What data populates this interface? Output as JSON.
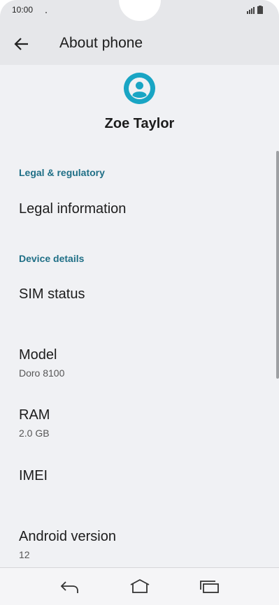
{
  "status_bar": {
    "time": "10:00"
  },
  "app_bar": {
    "title": "About phone",
    "back_icon": "arrow-left-icon"
  },
  "profile": {
    "name": "Zoe Taylor",
    "avatar_icon": "account-circle-icon",
    "accent": "#19a5c4"
  },
  "sections": {
    "legal": {
      "header": "Legal & regulatory",
      "legal_information": "Legal information"
    },
    "device": {
      "header": "Device details",
      "sim_status": "SIM status",
      "model_label": "Model",
      "model_value": "Doro 8100",
      "ram_label": "RAM",
      "ram_value": "2.0 GB",
      "imei_label": "IMEI",
      "android_label": "Android version",
      "android_value": "12"
    }
  },
  "colors": {
    "section_header": "#1f6f86",
    "background": "#f0f1f4",
    "bar": "#e6e7ea"
  },
  "nav_bar": {
    "icons": [
      "back-icon",
      "home-icon",
      "recents-icon"
    ]
  }
}
